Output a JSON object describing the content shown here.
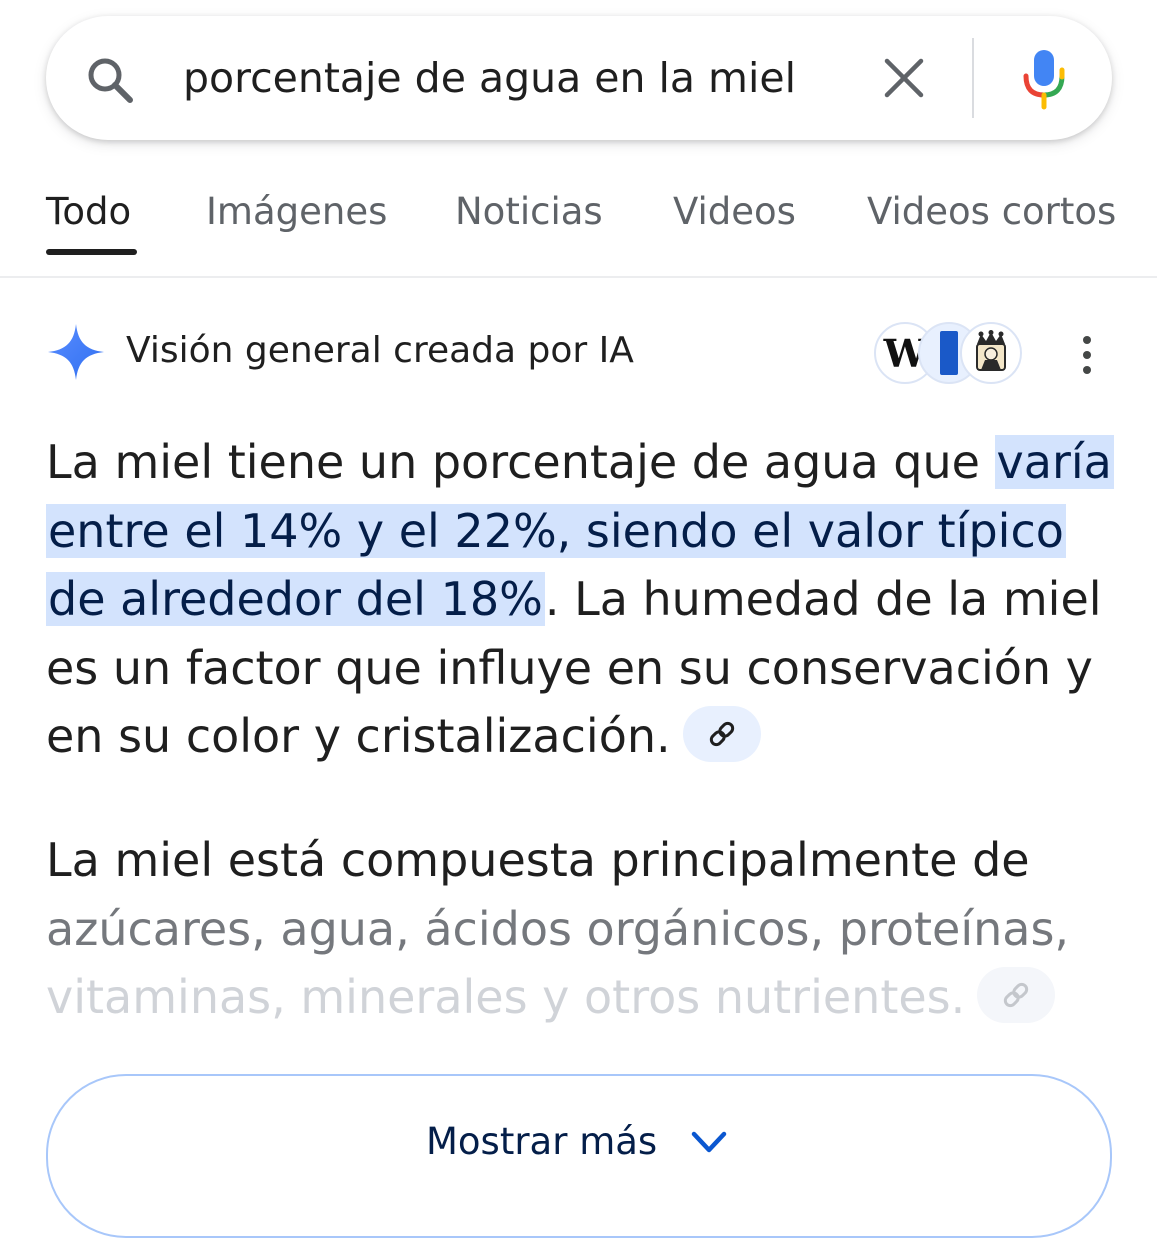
{
  "search": {
    "query": "porcentaje de agua en la miel",
    "search_icon": "search-icon",
    "clear_icon": "close-icon",
    "mic_icon": "microphone-icon"
  },
  "tabs": [
    {
      "label": "Todo",
      "active": true
    },
    {
      "label": "Imágenes",
      "active": false
    },
    {
      "label": "Noticias",
      "active": false
    },
    {
      "label": "Videos",
      "active": false
    },
    {
      "label": "Videos cortos",
      "active": false
    }
  ],
  "ai_overview": {
    "title": "Visión general creada por IA",
    "sparkle_icon": "sparkle-icon",
    "sources": [
      {
        "logo": "wikipedia-logo",
        "glyph": "W"
      },
      {
        "logo": "blue-bar-logo"
      },
      {
        "logo": "queen-logo"
      }
    ],
    "menu_icon": "more-vert-icon",
    "paragraph1": {
      "before": "La miel tiene un porcentaje de agua que ",
      "highlight": "varía entre el 14% y el 22%, siendo el valor típico de alrededor del 18%",
      "after": ". La humedad de la miel es un factor que influye en su conservación y en su color y cristalización."
    },
    "paragraph2": {
      "line1": "La miel está compuesta principalmente de",
      "line2": "azúcares, agua, ácidos orgánicos, proteínas,",
      "line3": "vitaminas, minerales y otros nutrientes."
    },
    "link_icon": "link-icon",
    "show_more": {
      "label": "Mostrar más",
      "icon": "chevron-down-icon"
    }
  },
  "colors": {
    "highlight_bg": "#d3e3fd",
    "highlight_text": "#041e49",
    "gemini_blue": "#4285f4",
    "button_border": "#a8c7fa",
    "tab_inactive": "#5f6368"
  }
}
